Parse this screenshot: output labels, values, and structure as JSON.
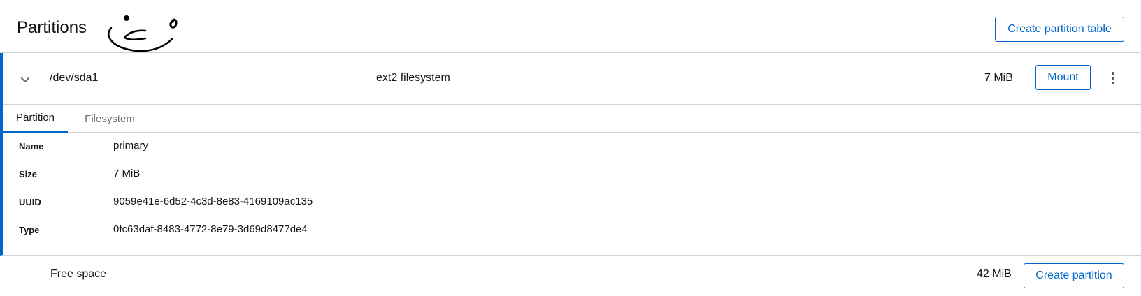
{
  "header": {
    "title": "Partitions",
    "create_table_label": "Create partition table"
  },
  "partition": {
    "device": "/dev/sda1",
    "fs_type": "ext2 filesystem",
    "size": "7 MiB",
    "mount_label": "Mount",
    "tabs": [
      {
        "label": "Partition",
        "active": true
      },
      {
        "label": "Filesystem",
        "active": false
      }
    ],
    "details": [
      {
        "label": "Name",
        "value": "primary"
      },
      {
        "label": "Size",
        "value": "7 MiB"
      },
      {
        "label": "UUID",
        "value": "9059e41e-6d52-4c3d-8e83-4169109ac135"
      },
      {
        "label": "Type",
        "value": "0fc63daf-8483-4772-8e79-3d69d8477de4"
      }
    ]
  },
  "free_space": {
    "label": "Free space",
    "size": "42 MiB",
    "create_label": "Create partition"
  },
  "colors": {
    "accent": "#0066cc",
    "border": "#d2d2d2",
    "muted_text": "#6a6e73"
  },
  "icons": {
    "toggle": "chevron-down-icon",
    "menu": "kebab-menu-icon",
    "doodle": "smiley-doodle"
  }
}
